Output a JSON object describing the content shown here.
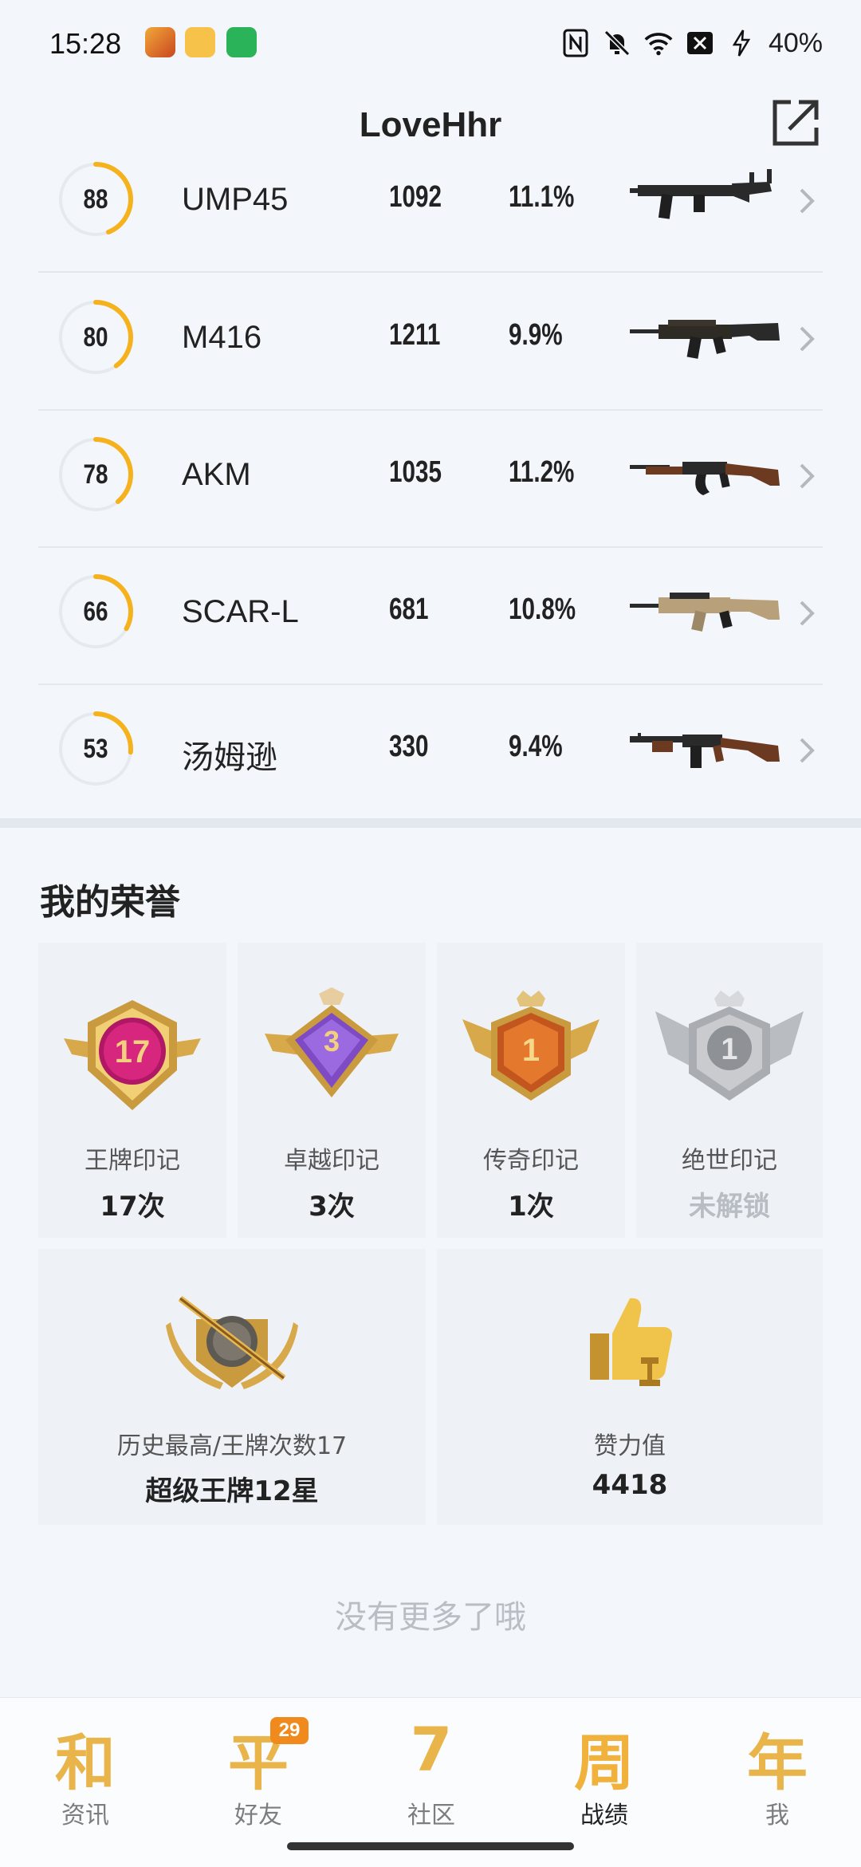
{
  "status_bar": {
    "time": "15:28",
    "battery": "40%",
    "icons": [
      "nfc-icon",
      "bell-muted-icon",
      "wifi-icon",
      "sim-x-icon",
      "charging-icon"
    ]
  },
  "header": {
    "title": "LoveHhr"
  },
  "weapons": [
    {
      "score": "88",
      "score_value": 88,
      "name": "UMP45",
      "kills": "1092",
      "rate": "11.1%",
      "gun": "smg"
    },
    {
      "score": "80",
      "score_value": 80,
      "name": "M416",
      "kills": "1211",
      "rate": "9.9%",
      "gun": "m416"
    },
    {
      "score": "78",
      "score_value": 78,
      "name": "AKM",
      "kills": "1035",
      "rate": "11.2%",
      "gun": "akm"
    },
    {
      "score": "66",
      "score_value": 66,
      "name": "SCAR-L",
      "kills": "681",
      "rate": "10.8%",
      "gun": "scar"
    },
    {
      "score": "53",
      "score_value": 53,
      "name": "汤姆逊",
      "kills": "330",
      "rate": "9.4%",
      "gun": "tommy"
    }
  ],
  "honors": {
    "title": "我的荣誉",
    "marks": [
      {
        "label": "王牌印记",
        "value": "17次",
        "badge_number": "17",
        "tier": "ace",
        "locked": false
      },
      {
        "label": "卓越印记",
        "value": "3次",
        "badge_number": "3",
        "tier": "excellence",
        "locked": false
      },
      {
        "label": "传奇印记",
        "value": "1次",
        "badge_number": "1",
        "tier": "legend",
        "locked": false
      },
      {
        "label": "绝世印记",
        "value": "未解锁",
        "badge_number": "1",
        "tier": "peerless",
        "locked": true
      }
    ],
    "highest": {
      "label": "历史最高/王牌次数17",
      "value": "超级王牌12星"
    },
    "likes": {
      "label": "赞力值",
      "value": "4418"
    }
  },
  "footer_text": "没有更多了哦",
  "tabs": [
    {
      "glyph": "和",
      "label": "资讯",
      "active": false
    },
    {
      "glyph": "平",
      "label": "好友",
      "active": false,
      "badge": "29"
    },
    {
      "glyph": "7",
      "label": "社区",
      "active": false
    },
    {
      "glyph": "周",
      "label": "战绩",
      "active": true
    },
    {
      "glyph": "年",
      "label": "我",
      "active": false
    }
  ],
  "colors": {
    "gauge": "#f5b21c",
    "gauge_track": "#e6e9ee",
    "gold": "#e9b54a",
    "badge_orange": "#f08a1c"
  }
}
